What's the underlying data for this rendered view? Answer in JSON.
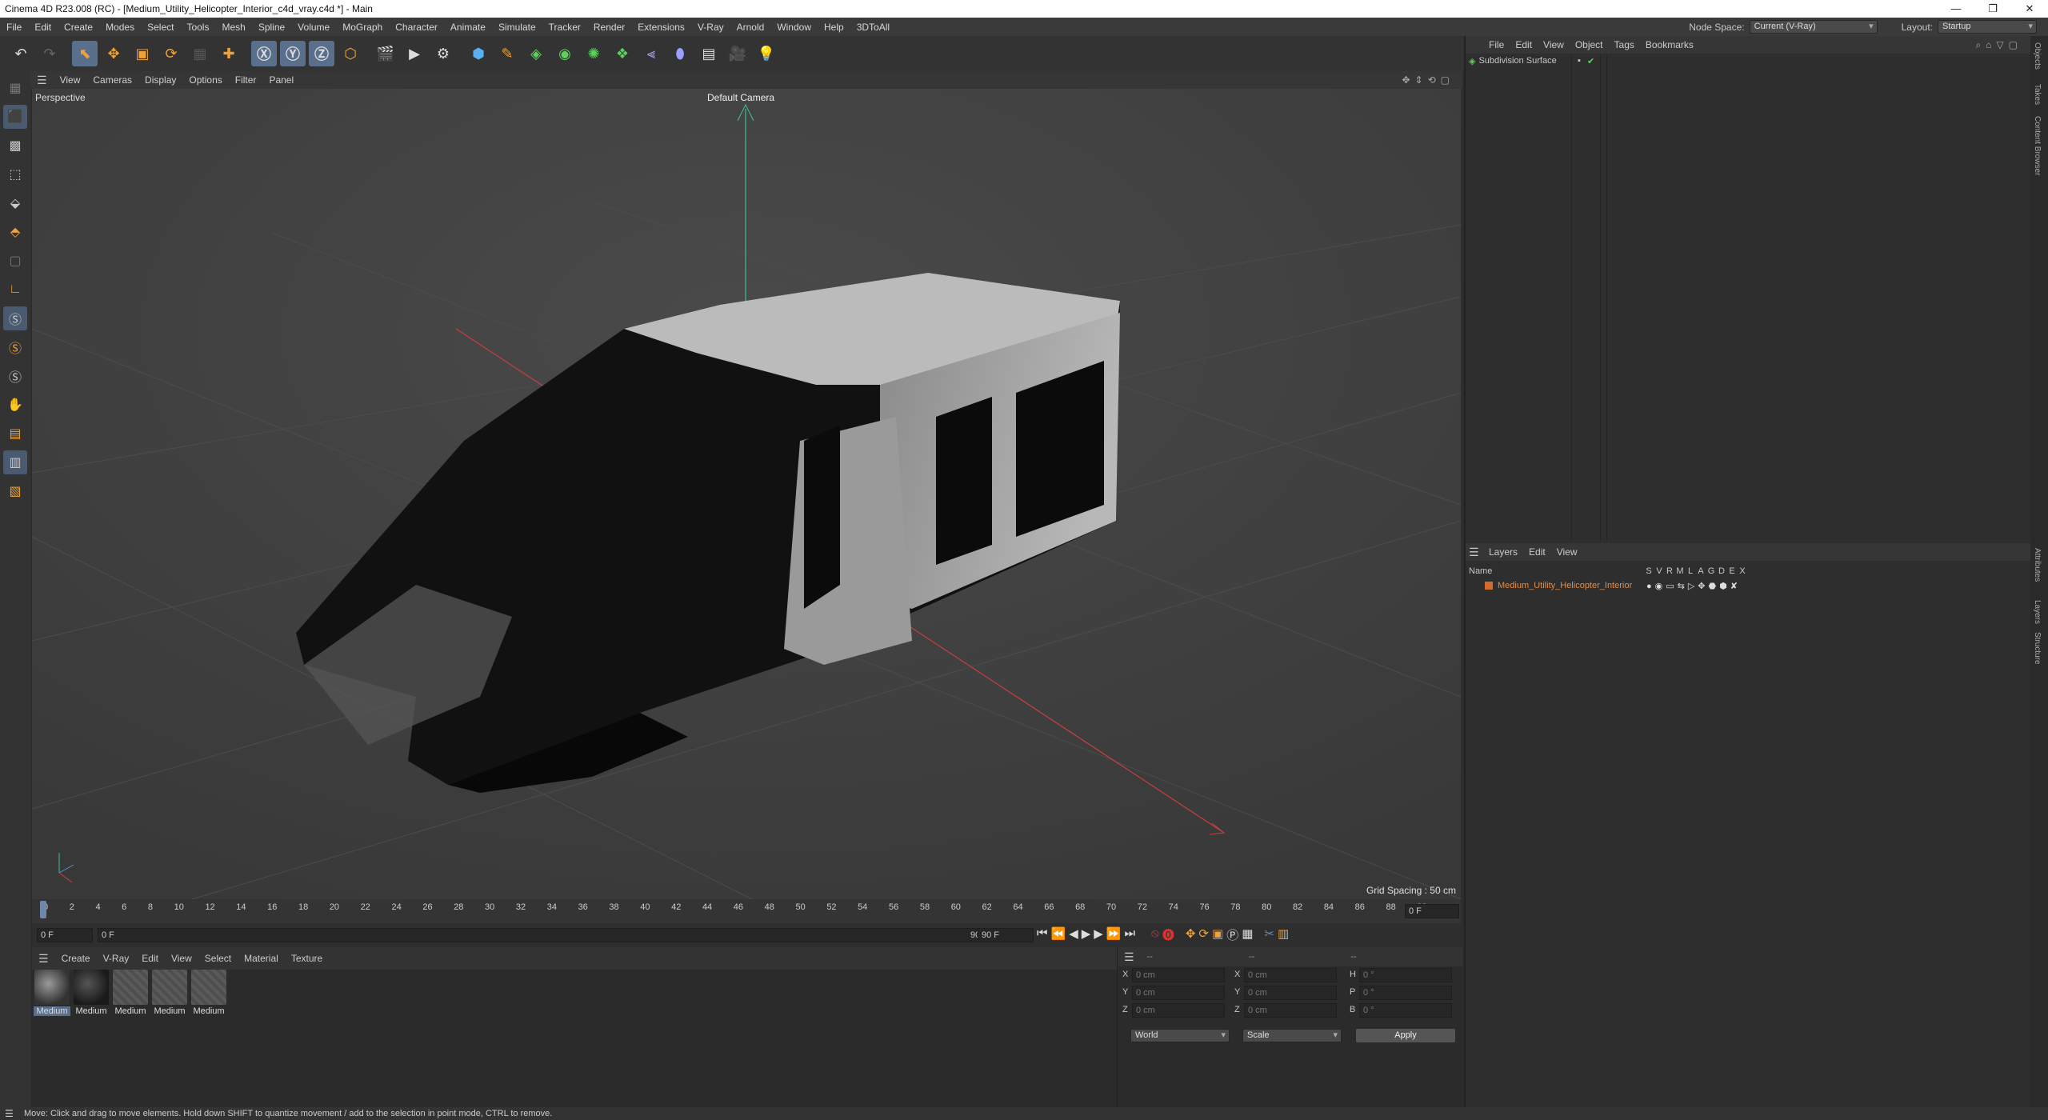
{
  "window": {
    "title": "Cinema 4D R23.008 (RC) - [Medium_Utility_Helicopter_Interior_c4d_vray.c4d *] - Main",
    "min_icon": "minimize-icon",
    "max_icon": "restore-icon",
    "close_icon": "close-icon"
  },
  "menu": {
    "items": [
      "File",
      "Edit",
      "Create",
      "Modes",
      "Select",
      "Tools",
      "Mesh",
      "Spline",
      "Volume",
      "MoGraph",
      "Character",
      "Animate",
      "Simulate",
      "Tracker",
      "Render",
      "Extensions",
      "V-Ray",
      "Arnold",
      "Window",
      "Help",
      "3DToAll"
    ],
    "node_space_label": "Node Space:",
    "node_space_value": "Current (V-Ray)",
    "layout_label": "Layout:",
    "layout_value": "Startup"
  },
  "viewport": {
    "menu": [
      "View",
      "Cameras",
      "Display",
      "Options",
      "Filter",
      "Panel"
    ],
    "view_name": "Perspective",
    "camera": "Default Camera",
    "grid_spacing": "Grid Spacing : 50 cm"
  },
  "timeline": {
    "ticks": [
      "0",
      "2",
      "4",
      "6",
      "8",
      "10",
      "12",
      "14",
      "16",
      "18",
      "20",
      "22",
      "24",
      "26",
      "28",
      "30",
      "32",
      "34",
      "36",
      "38",
      "40",
      "42",
      "44",
      "46",
      "48",
      "50",
      "52",
      "54",
      "56",
      "58",
      "60",
      "62",
      "64",
      "66",
      "68",
      "70",
      "72",
      "74",
      "76",
      "78",
      "80",
      "82",
      "84",
      "86",
      "88",
      "90"
    ],
    "current_frame": "0 F",
    "start_frame": "0 F",
    "range_start": "0 F",
    "range_end": "90 F",
    "end_frame": "90 F"
  },
  "material_manager": {
    "menu": [
      "Create",
      "V-Ray",
      "Edit",
      "View",
      "Select",
      "Material",
      "Texture"
    ],
    "materials": [
      "Medium",
      "Medium",
      "Medium",
      "Medium",
      "Medium"
    ]
  },
  "coordinates": {
    "header": [
      "--",
      "--",
      "--"
    ],
    "rows": [
      {
        "a": "X",
        "av": "0 cm",
        "b": "X",
        "bv": "0 cm",
        "c": "H",
        "cv": "0 °"
      },
      {
        "a": "Y",
        "av": "0 cm",
        "b": "Y",
        "bv": "0 cm",
        "c": "P",
        "cv": "0 °"
      },
      {
        "a": "Z",
        "av": "0 cm",
        "b": "Z",
        "bv": "0 cm",
        "c": "B",
        "cv": "0 °"
      }
    ],
    "mode1": "World",
    "mode2": "Scale",
    "apply": "Apply"
  },
  "objects": {
    "menu": [
      "File",
      "Edit",
      "View",
      "Object",
      "Tags",
      "Bookmarks"
    ],
    "items": [
      {
        "name": "Subdivision Surface"
      }
    ]
  },
  "layers": {
    "menu": [
      "Layers",
      "Edit",
      "View"
    ],
    "name_header": "Name",
    "col_headers": [
      "S",
      "V",
      "R",
      "M",
      "L",
      "A",
      "G",
      "D",
      "E",
      "X"
    ],
    "items": [
      {
        "name": "Medium_Utility_Helicopter_Interior",
        "color": "#d66a2a"
      }
    ]
  },
  "side_tabs": [
    "Objects",
    "Takes",
    "Content Browser",
    "Attributes",
    "Layers",
    "Structure"
  ],
  "status": "Move: Click and drag to move elements. Hold down SHIFT to quantize movement / add to the selection in point mode, CTRL to remove."
}
